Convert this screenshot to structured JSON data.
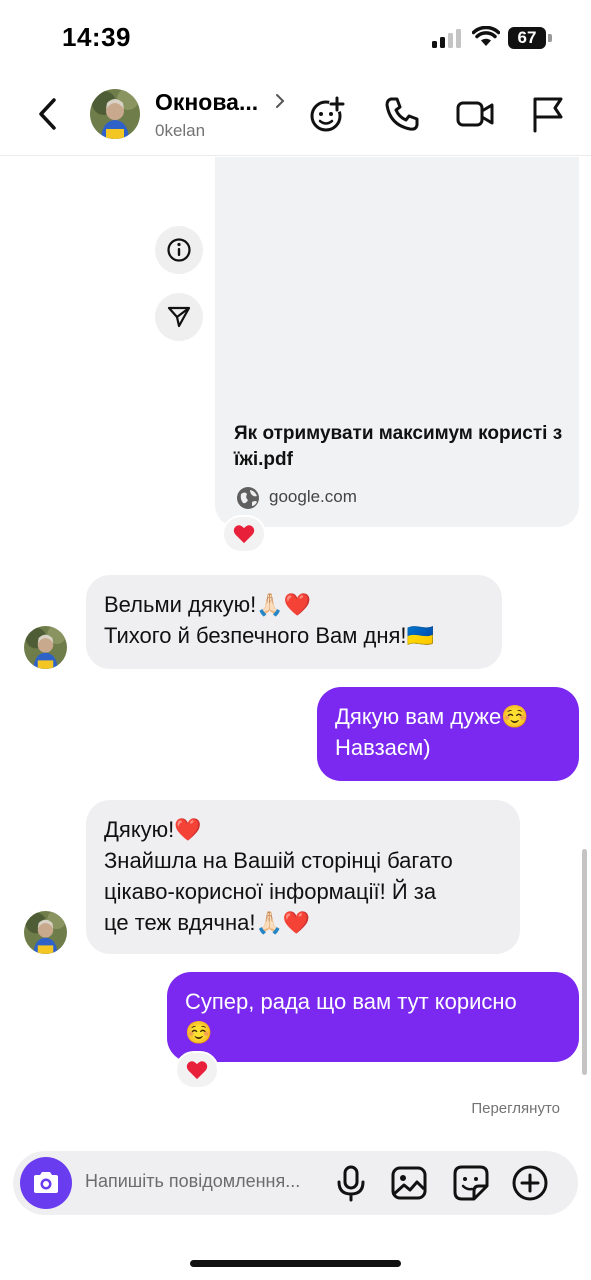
{
  "status_bar": {
    "time": "14:39",
    "battery": "67"
  },
  "header": {
    "name": "Окнова...",
    "username": "0kelan",
    "icons": [
      "back-icon",
      "add-emoji-icon",
      "phone-icon",
      "video-icon",
      "flag-icon"
    ]
  },
  "link_card": {
    "title": "Як отримувати максимум користі з їжі.pdf",
    "domain": "google.com"
  },
  "messages": [
    {
      "direction": "in",
      "lines": [
        "Вельми дякую!🙏🏻❤️",
        "Тихого й безпечного Вам дня!🇺🇦"
      ]
    },
    {
      "direction": "out",
      "lines": [
        "Дякую вам дуже☺️",
        "Навзаєм)"
      ]
    },
    {
      "direction": "in",
      "lines": [
        "Дякую!❤️",
        "Знайшла на Вашій сторінці багато",
        "цікаво-корисної інформації! Й за",
        "це теж вдячна!🙏🏻❤️"
      ]
    },
    {
      "direction": "out",
      "lines": [
        "Супер, рада що вам тут корисно",
        "☺️"
      ]
    }
  ],
  "seen_label": "Переглянуто",
  "composer": {
    "placeholder": "Напишіть повідомлення..."
  },
  "colors": {
    "outgoing_bubble": "#7b29f0",
    "incoming_bubble": "#efeff1",
    "camera_button": "#6a3cf0",
    "heart": "#e8203a"
  }
}
